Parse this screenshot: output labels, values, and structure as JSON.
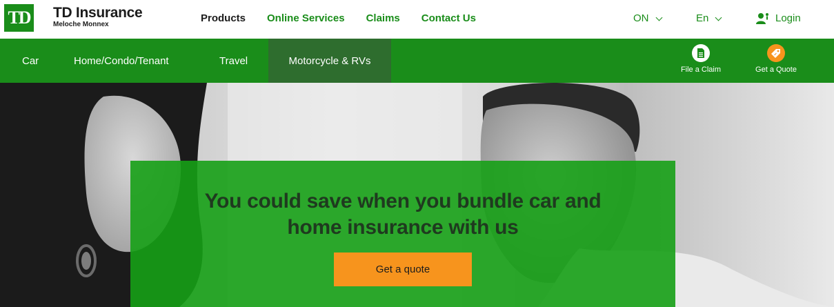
{
  "brand": {
    "logo_text": "TD",
    "name": "TD Insurance",
    "sub": "Meloche Monnex",
    "green": "#1a8d1a"
  },
  "main_nav": [
    {
      "label": "Products"
    },
    {
      "label": "Online Services"
    },
    {
      "label": "Claims"
    },
    {
      "label": "Contact Us"
    }
  ],
  "utility": {
    "province": "ON",
    "language": "En",
    "login": "Login"
  },
  "sub_nav": [
    {
      "label": "Car"
    },
    {
      "label": "Home/Condo/Tenant"
    },
    {
      "label": "Travel"
    },
    {
      "label": "Motorcycle & RVs",
      "active": true
    }
  ],
  "actions": {
    "file_claim": {
      "label": "File a Claim",
      "icon": "document-icon"
    },
    "get_quote": {
      "label": "Get a Quote",
      "icon": "price-tag-icon",
      "color": "#f7941d"
    }
  },
  "hero": {
    "headline": "You could save when you bundle car and home insurance with us",
    "cta": "Get a quote",
    "cta_color": "#f7941d"
  }
}
